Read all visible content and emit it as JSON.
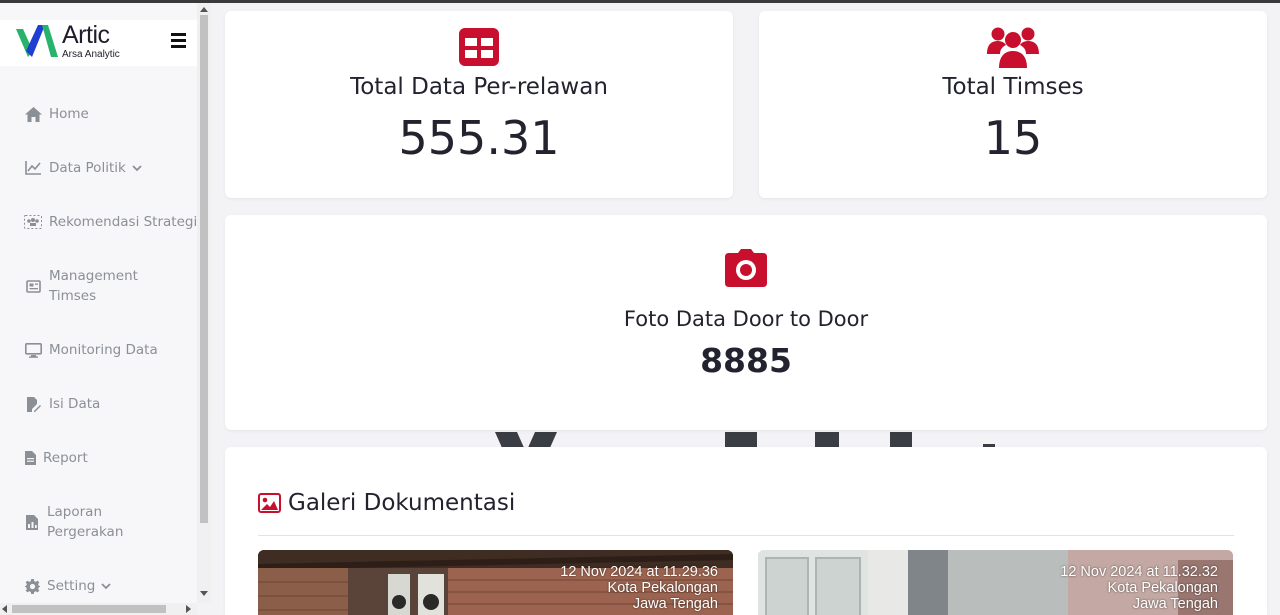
{
  "brand": {
    "title": "Artic",
    "subtitle": "Arsa Analytic",
    "colors": {
      "green": "#27b36b",
      "blue": "#1f3fd1"
    }
  },
  "sidebar": {
    "items": [
      {
        "label": "Home",
        "icon": "home-icon",
        "has_chevron": false
      },
      {
        "label": "Data Politik",
        "icon": "chart-line-icon",
        "has_chevron": true
      },
      {
        "label": "Rekomendasi Strategi",
        "icon": "users-group-icon",
        "has_chevron": false
      },
      {
        "label": "Management Timses",
        "icon": "newspaper-icon",
        "has_chevron": false
      },
      {
        "label": "Monitoring Data",
        "icon": "monitor-icon",
        "has_chevron": false
      },
      {
        "label": "Isi Data",
        "icon": "edit-file-icon",
        "has_chevron": false
      },
      {
        "label": "Report",
        "icon": "file-icon",
        "has_chevron": false
      },
      {
        "label": "Laporan Pergerakan",
        "icon": "file-chart-icon",
        "has_chevron": false
      },
      {
        "label": "Setting",
        "icon": "gear-icon",
        "has_chevron": true
      }
    ]
  },
  "stats": {
    "relawan": {
      "title": "Total Data Per-relawan",
      "value": "555.31",
      "icon": "table-icon"
    },
    "timses": {
      "title": "Total Timses",
      "value": "15",
      "icon": "users-icon"
    },
    "foto": {
      "title": "Foto Data Door to Door",
      "value": "8885",
      "icon": "camera-icon"
    }
  },
  "gallery": {
    "title": "Galeri Dokumentasi",
    "icon": "image-icon",
    "photos": [
      {
        "date": "12 Nov 2024 at 11.29.36",
        "city": "Kota Pekalongan",
        "province": "Jawa Tengah"
      },
      {
        "date": "12 Nov 2024 at 11.32.32",
        "city": "Kota Pekalongan",
        "province": "Jawa Tengah"
      }
    ]
  },
  "colors": {
    "accent": "#c8102e",
    "text": "#232330",
    "nav_text": "#8b8f96"
  }
}
